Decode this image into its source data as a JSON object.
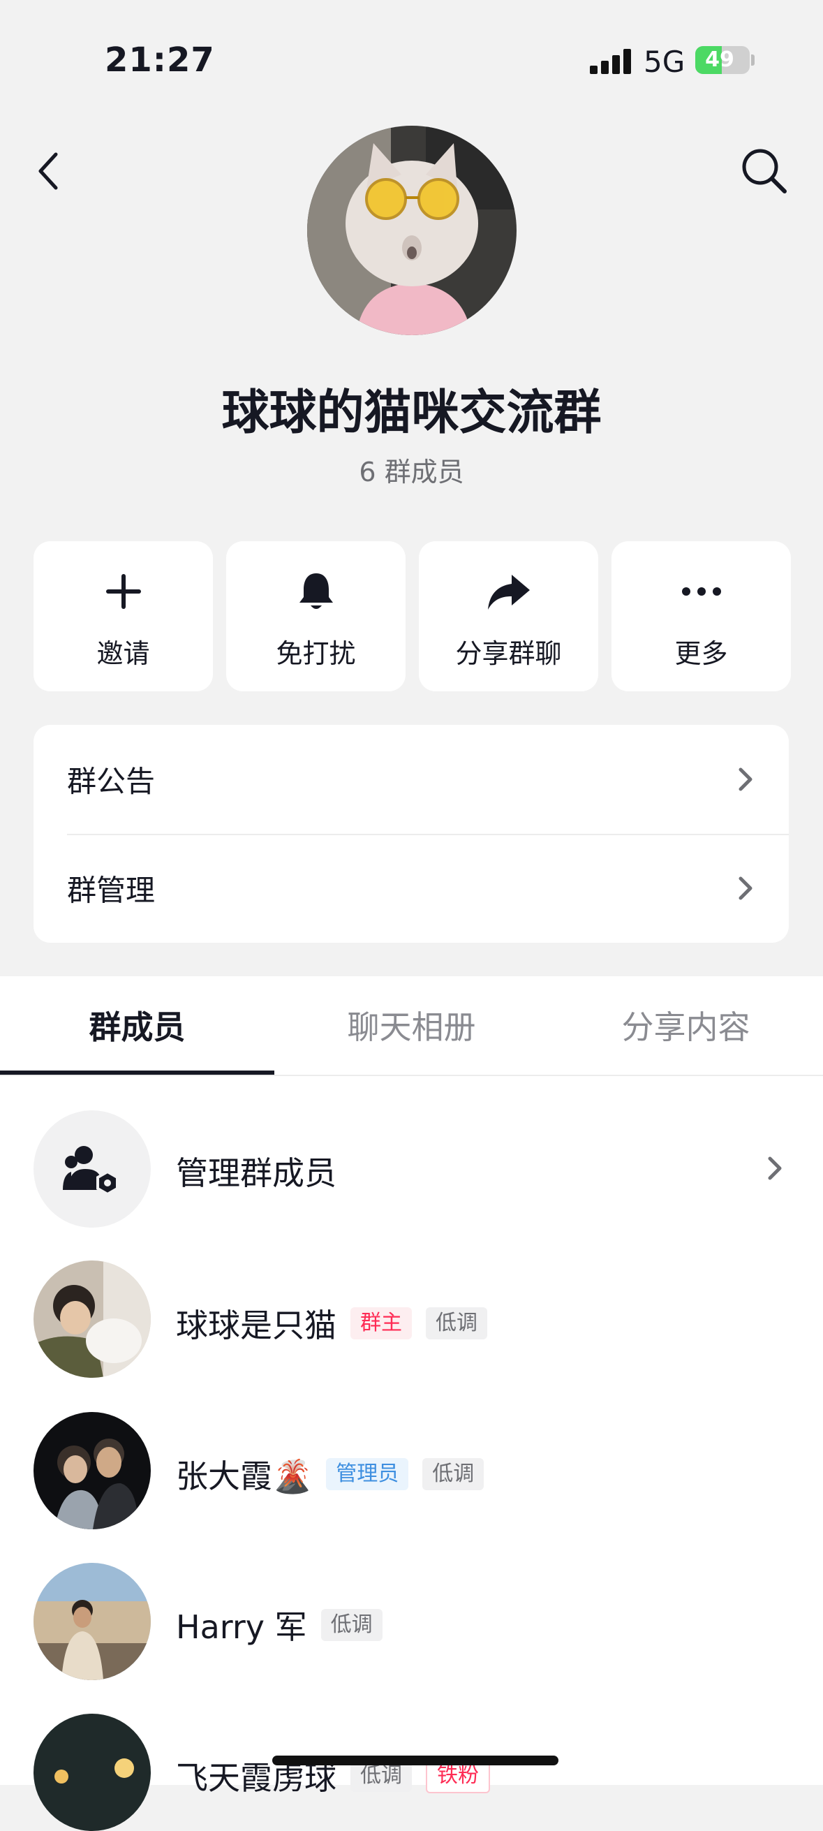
{
  "status_bar": {
    "time": "21:27",
    "network": "5G",
    "battery": "49",
    "battery_level": 0.49
  },
  "header": {
    "back_icon": "chevron-left-icon",
    "search_icon": "search-icon"
  },
  "group": {
    "name": "球球的猫咪交流群",
    "member_count": "6 群成员",
    "avatar": "cat-with-yellow-sunglasses"
  },
  "actions": [
    {
      "label": "邀请",
      "icon": "plus-icon"
    },
    {
      "label": "免打扰",
      "icon": "bell-icon"
    },
    {
      "label": "分享群聊",
      "icon": "share-arrow-icon"
    },
    {
      "label": "更多",
      "icon": "more-dots-icon"
    }
  ],
  "settings": [
    {
      "label": "群公告"
    },
    {
      "label": "群管理"
    }
  ],
  "tabs": [
    {
      "label": "群成员",
      "active": true
    },
    {
      "label": "聊天相册",
      "active": false
    },
    {
      "label": "分享内容",
      "active": false
    }
  ],
  "manage_row": {
    "label": "管理群成员",
    "icon": "manage-members-icon"
  },
  "members": [
    {
      "name": "球球是只猫",
      "tags": [
        "群主",
        "低调"
      ]
    },
    {
      "name": "张大霞🌋",
      "tags": [
        "管理员",
        "低调"
      ]
    },
    {
      "name": "Harry 军",
      "tags": [
        "低调"
      ]
    },
    {
      "name": "飞天霞虏球",
      "tags": [
        "低调",
        "铁粉"
      ]
    }
  ],
  "colors": {
    "accent_red": "#fe2c55",
    "admin_blue": "#3e8fe0",
    "text_primary": "#161823",
    "background": "#f2f2f2"
  }
}
